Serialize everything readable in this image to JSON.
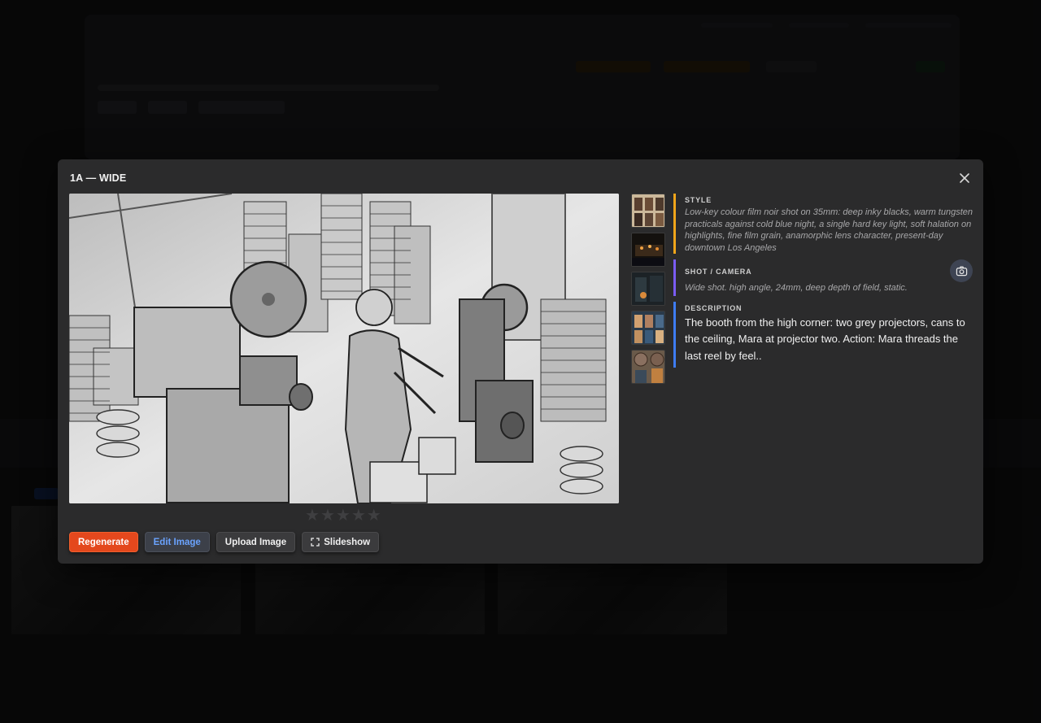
{
  "modal": {
    "title": "1A — WIDE",
    "close_icon": "close-icon"
  },
  "rating": {
    "stars_total": 5,
    "stars_filled": 0
  },
  "actions": {
    "regenerate": "Regenerate",
    "edit_image": "Edit Image",
    "upload_image": "Upload Image",
    "slideshow": "Slideshow"
  },
  "info": {
    "style": {
      "label": "STYLE",
      "text": "Low-key colour film noir shot on 35mm: deep inky blacks, warm tungsten practicals against cold blue night, a single hard key light, soft halation on highlights, fine film grain, anamorphic lens character, present-day downtown Los Angeles"
    },
    "shot": {
      "label": "SHOT / CAMERA",
      "text": "Wide shot. high angle, 24mm, deep depth of field, static."
    },
    "description": {
      "label": "DESCRIPTION",
      "text": "The booth from the high corner: two grey projectors, cans to the ceiling, Mara at projector two. Action: Mara threads the last reel by feel.."
    }
  },
  "colors": {
    "accent_regenerate": "#e4481d",
    "edit_link": "#6aa3ff",
    "style_bar": "#f0a51a",
    "shot_bar": "#7a5cf2",
    "description_bar": "#3e7cf2"
  }
}
